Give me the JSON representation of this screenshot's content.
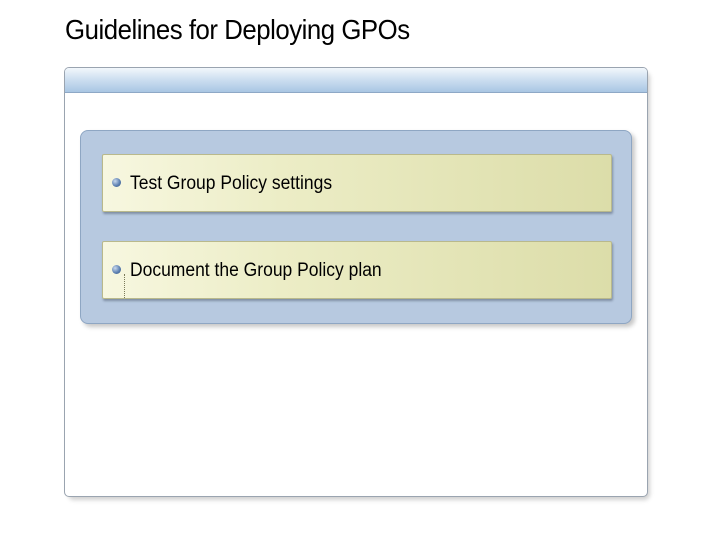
{
  "slide": {
    "title": "Guidelines for Deploying GPOs",
    "bullets": [
      {
        "label": "Test Group Policy settings"
      },
      {
        "label": "Document the Group Policy plan"
      }
    ]
  },
  "colors": {
    "frame_header": "#b9d0e8",
    "panel_background": "#b7c9e0",
    "bullet_box": "#e6e7bd",
    "bullet_dot": "#5f82b3"
  },
  "icons": {
    "bullet": "bullet-dot-icon"
  }
}
